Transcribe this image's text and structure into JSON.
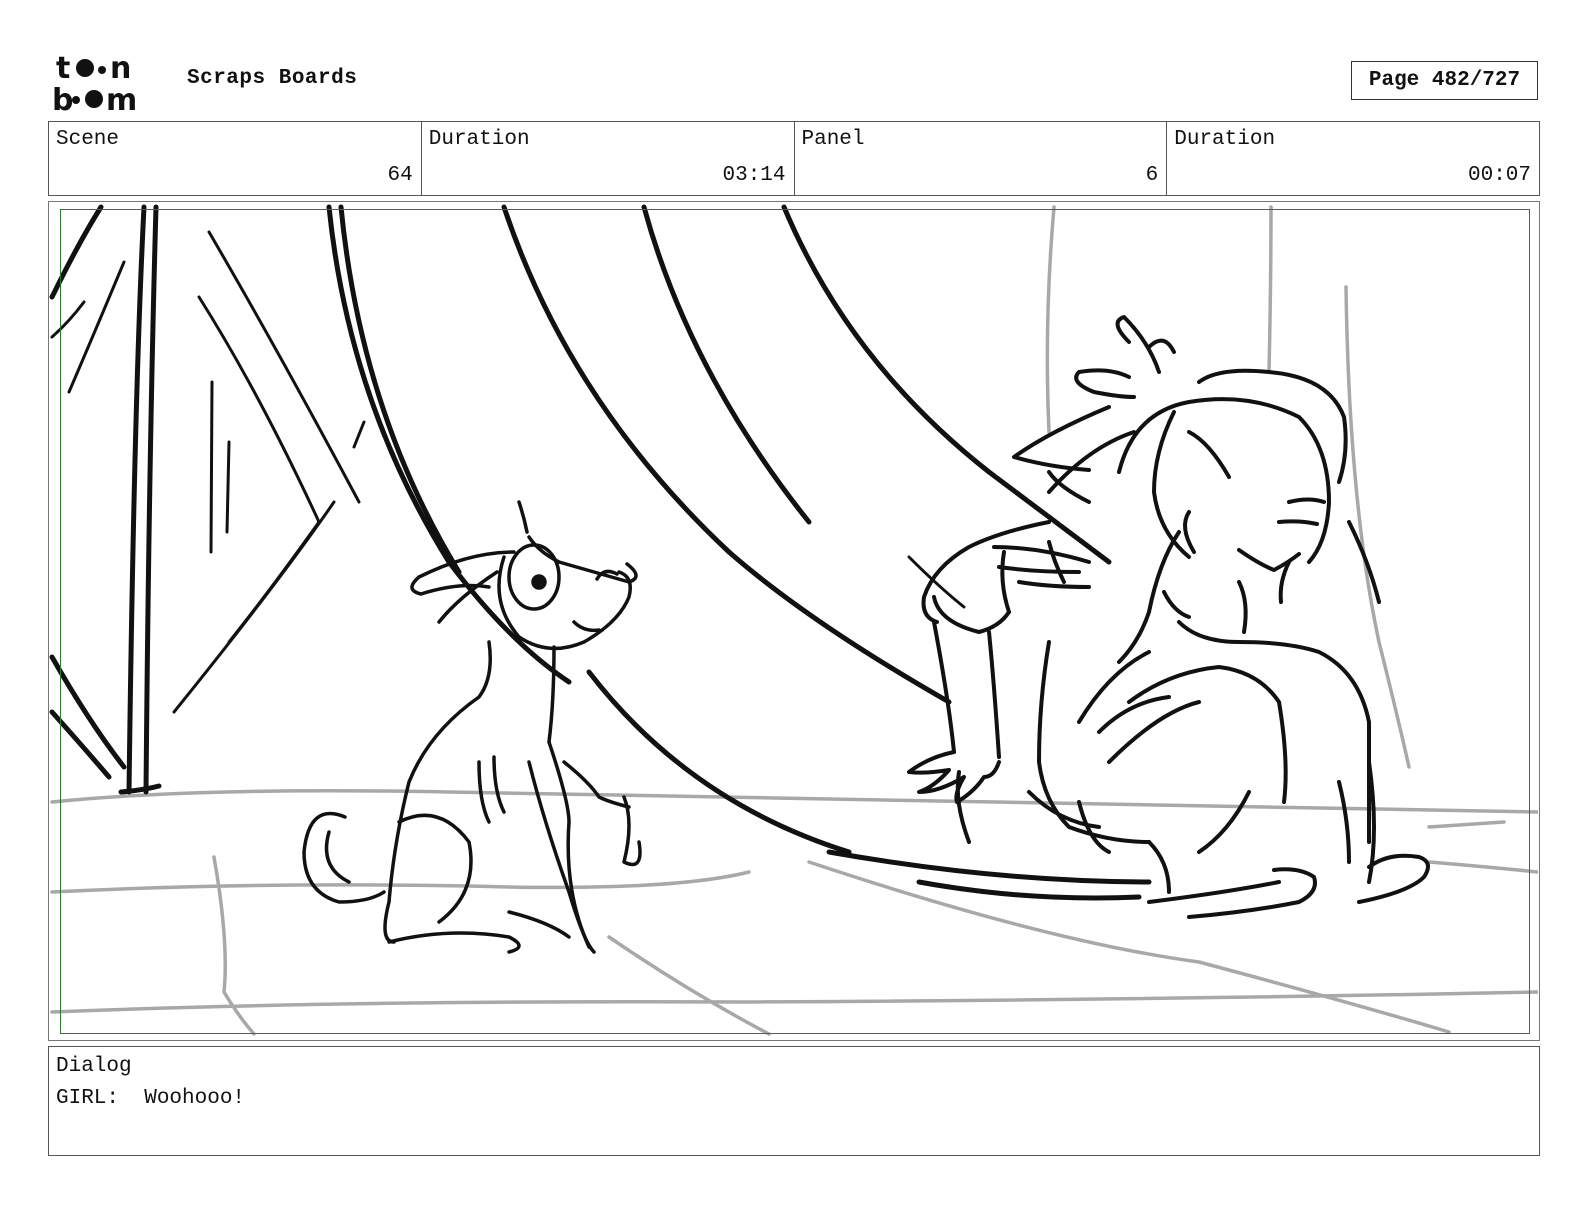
{
  "header": {
    "logo_text": "toon boom",
    "board_title": "Scraps Boards",
    "page_indicator": "Page 482/727"
  },
  "info": {
    "scene_label": "Scene",
    "scene_value": "64",
    "scene_duration_label": "Duration",
    "scene_duration_value": "03:14",
    "panel_label": "Panel",
    "panel_value": "6",
    "panel_duration_label": "Duration",
    "panel_duration_value": "00:07"
  },
  "dialog": {
    "label": "Dialog",
    "text": "GIRL:  Woohooo!"
  },
  "colors": {
    "safe_area": "#2a7a2a",
    "ink": "#111111",
    "ground_lines": "#a8a8a8"
  }
}
